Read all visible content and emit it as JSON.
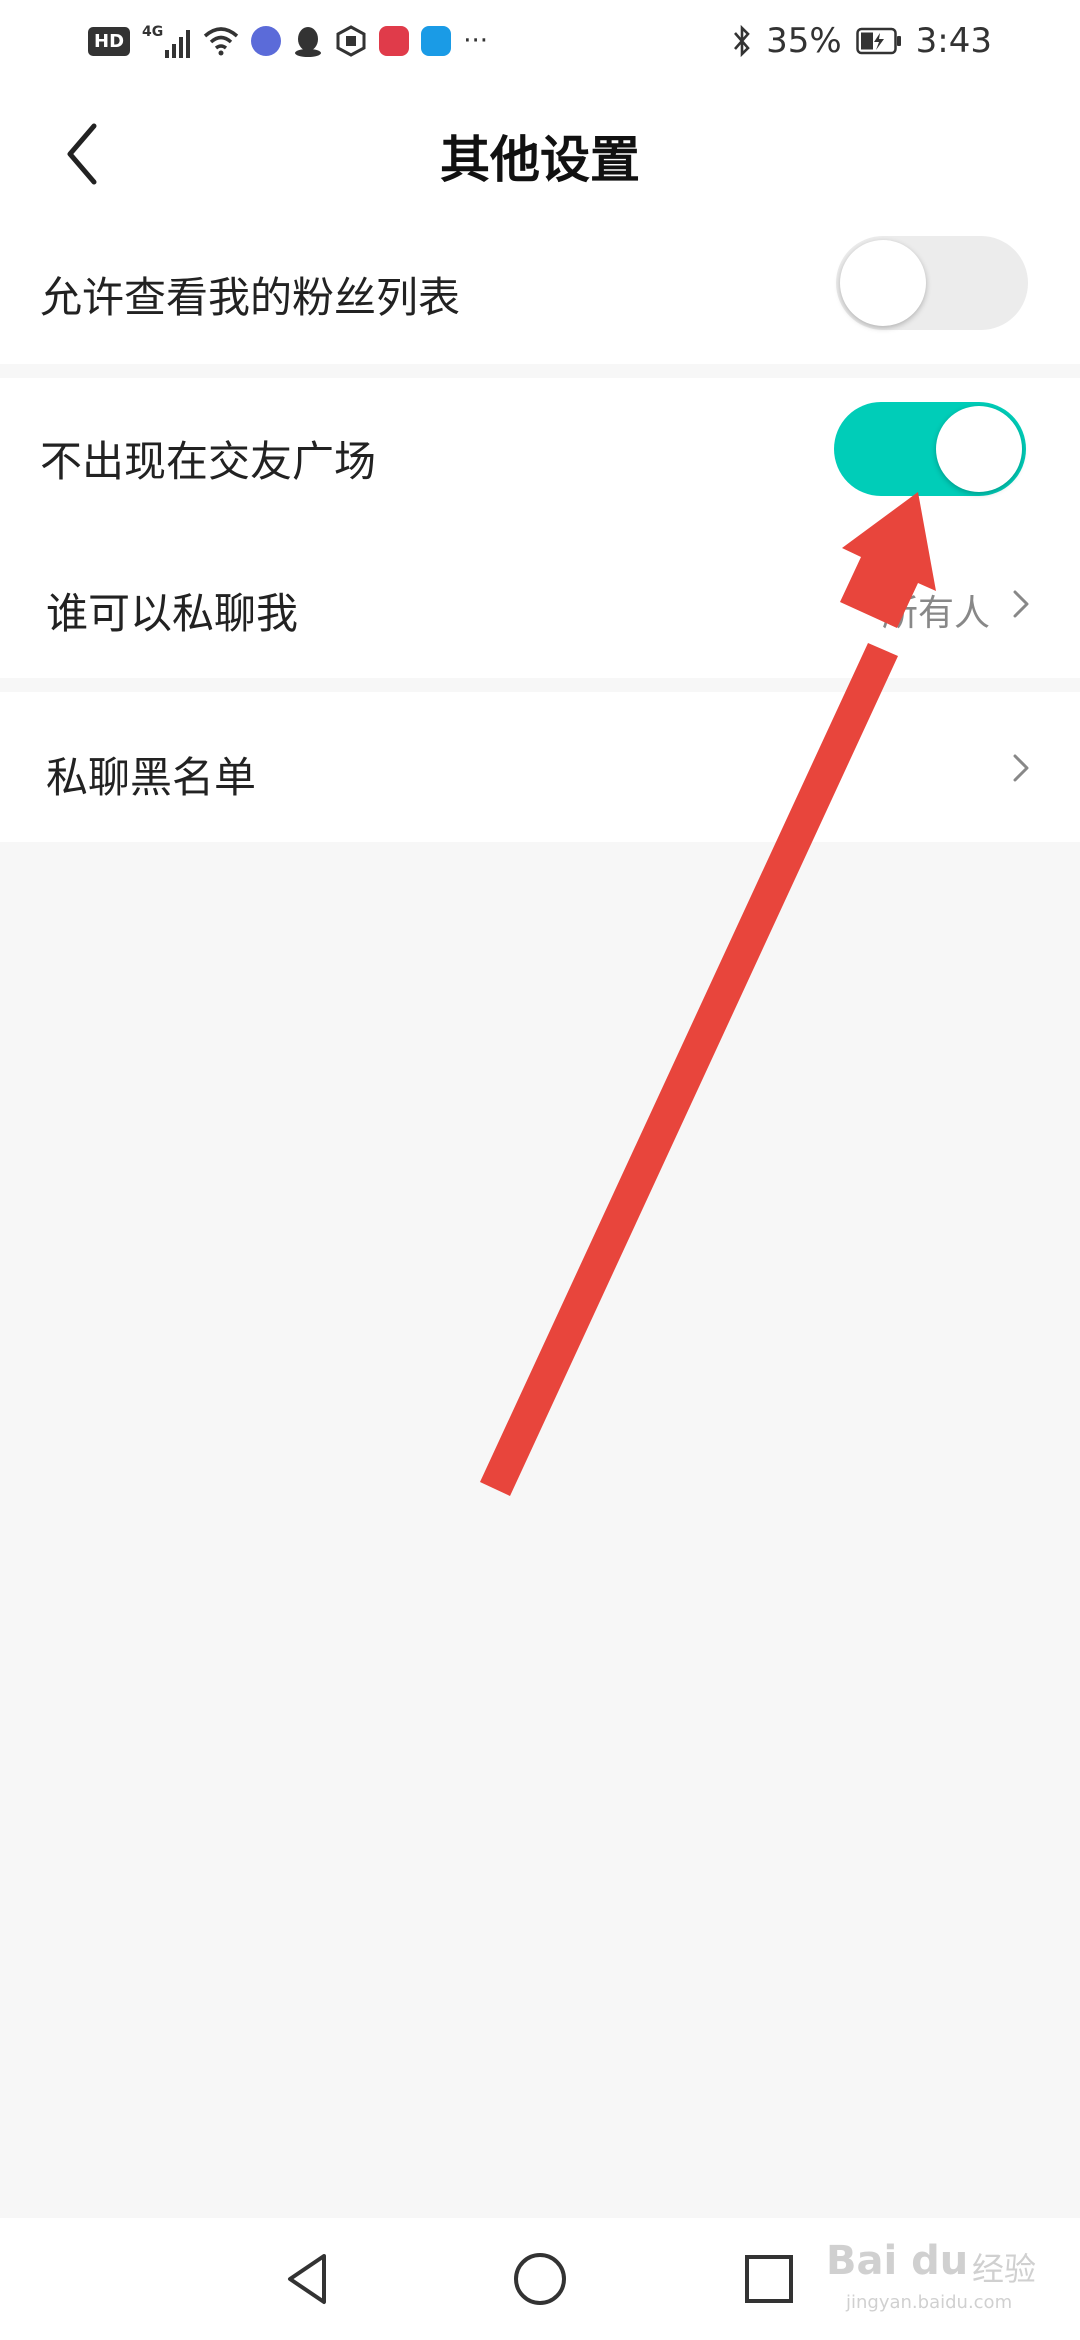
{
  "status_bar": {
    "hd": "HD",
    "network": "4G",
    "battery": "35%",
    "time": "3:43",
    "more": "···"
  },
  "header": {
    "title": "其他设置"
  },
  "settings": {
    "fans_list": {
      "label": "允许查看我的粉丝列表",
      "enabled": false
    },
    "friend_square": {
      "label": "不出现在交友广场",
      "enabled": true
    },
    "who_can_message": {
      "label": "谁可以私聊我",
      "value": "所有人"
    },
    "message_blacklist": {
      "label": "私聊黑名单"
    }
  },
  "colors": {
    "toggle_on": "#00cdb8",
    "toggle_off": "#ececec",
    "annotation_arrow": "#e8453c"
  },
  "watermark": {
    "brand": "Bai du",
    "suffix": "经验",
    "url": "jingyan.baidu.com"
  }
}
